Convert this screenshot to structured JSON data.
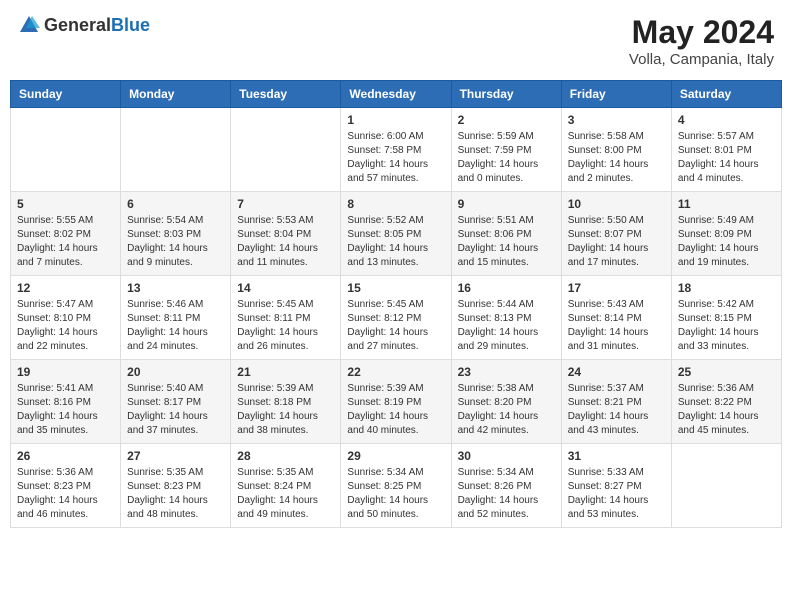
{
  "header": {
    "logo_general": "General",
    "logo_blue": "Blue",
    "month_title": "May 2024",
    "location": "Volla, Campania, Italy"
  },
  "days_of_week": [
    "Sunday",
    "Monday",
    "Tuesday",
    "Wednesday",
    "Thursday",
    "Friday",
    "Saturday"
  ],
  "weeks": [
    [
      {
        "day": "",
        "sunrise": "",
        "sunset": "",
        "daylight": ""
      },
      {
        "day": "",
        "sunrise": "",
        "sunset": "",
        "daylight": ""
      },
      {
        "day": "",
        "sunrise": "",
        "sunset": "",
        "daylight": ""
      },
      {
        "day": "1",
        "sunrise": "Sunrise: 6:00 AM",
        "sunset": "Sunset: 7:58 PM",
        "daylight": "Daylight: 14 hours and 57 minutes."
      },
      {
        "day": "2",
        "sunrise": "Sunrise: 5:59 AM",
        "sunset": "Sunset: 7:59 PM",
        "daylight": "Daylight: 14 hours and 0 minutes."
      },
      {
        "day": "3",
        "sunrise": "Sunrise: 5:58 AM",
        "sunset": "Sunset: 8:00 PM",
        "daylight": "Daylight: 14 hours and 2 minutes."
      },
      {
        "day": "4",
        "sunrise": "Sunrise: 5:57 AM",
        "sunset": "Sunset: 8:01 PM",
        "daylight": "Daylight: 14 hours and 4 minutes."
      }
    ],
    [
      {
        "day": "5",
        "sunrise": "Sunrise: 5:55 AM",
        "sunset": "Sunset: 8:02 PM",
        "daylight": "Daylight: 14 hours and 7 minutes."
      },
      {
        "day": "6",
        "sunrise": "Sunrise: 5:54 AM",
        "sunset": "Sunset: 8:03 PM",
        "daylight": "Daylight: 14 hours and 9 minutes."
      },
      {
        "day": "7",
        "sunrise": "Sunrise: 5:53 AM",
        "sunset": "Sunset: 8:04 PM",
        "daylight": "Daylight: 14 hours and 11 minutes."
      },
      {
        "day": "8",
        "sunrise": "Sunrise: 5:52 AM",
        "sunset": "Sunset: 8:05 PM",
        "daylight": "Daylight: 14 hours and 13 minutes."
      },
      {
        "day": "9",
        "sunrise": "Sunrise: 5:51 AM",
        "sunset": "Sunset: 8:06 PM",
        "daylight": "Daylight: 14 hours and 15 minutes."
      },
      {
        "day": "10",
        "sunrise": "Sunrise: 5:50 AM",
        "sunset": "Sunset: 8:07 PM",
        "daylight": "Daylight: 14 hours and 17 minutes."
      },
      {
        "day": "11",
        "sunrise": "Sunrise: 5:49 AM",
        "sunset": "Sunset: 8:09 PM",
        "daylight": "Daylight: 14 hours and 19 minutes."
      }
    ],
    [
      {
        "day": "12",
        "sunrise": "Sunrise: 5:47 AM",
        "sunset": "Sunset: 8:10 PM",
        "daylight": "Daylight: 14 hours and 22 minutes."
      },
      {
        "day": "13",
        "sunrise": "Sunrise: 5:46 AM",
        "sunset": "Sunset: 8:11 PM",
        "daylight": "Daylight: 14 hours and 24 minutes."
      },
      {
        "day": "14",
        "sunrise": "Sunrise: 5:45 AM",
        "sunset": "Sunset: 8:11 PM",
        "daylight": "Daylight: 14 hours and 26 minutes."
      },
      {
        "day": "15",
        "sunrise": "Sunrise: 5:45 AM",
        "sunset": "Sunset: 8:12 PM",
        "daylight": "Daylight: 14 hours and 27 minutes."
      },
      {
        "day": "16",
        "sunrise": "Sunrise: 5:44 AM",
        "sunset": "Sunset: 8:13 PM",
        "daylight": "Daylight: 14 hours and 29 minutes."
      },
      {
        "day": "17",
        "sunrise": "Sunrise: 5:43 AM",
        "sunset": "Sunset: 8:14 PM",
        "daylight": "Daylight: 14 hours and 31 minutes."
      },
      {
        "day": "18",
        "sunrise": "Sunrise: 5:42 AM",
        "sunset": "Sunset: 8:15 PM",
        "daylight": "Daylight: 14 hours and 33 minutes."
      }
    ],
    [
      {
        "day": "19",
        "sunrise": "Sunrise: 5:41 AM",
        "sunset": "Sunset: 8:16 PM",
        "daylight": "Daylight: 14 hours and 35 minutes."
      },
      {
        "day": "20",
        "sunrise": "Sunrise: 5:40 AM",
        "sunset": "Sunset: 8:17 PM",
        "daylight": "Daylight: 14 hours and 37 minutes."
      },
      {
        "day": "21",
        "sunrise": "Sunrise: 5:39 AM",
        "sunset": "Sunset: 8:18 PM",
        "daylight": "Daylight: 14 hours and 38 minutes."
      },
      {
        "day": "22",
        "sunrise": "Sunrise: 5:39 AM",
        "sunset": "Sunset: 8:19 PM",
        "daylight": "Daylight: 14 hours and 40 minutes."
      },
      {
        "day": "23",
        "sunrise": "Sunrise: 5:38 AM",
        "sunset": "Sunset: 8:20 PM",
        "daylight": "Daylight: 14 hours and 42 minutes."
      },
      {
        "day": "24",
        "sunrise": "Sunrise: 5:37 AM",
        "sunset": "Sunset: 8:21 PM",
        "daylight": "Daylight: 14 hours and 43 minutes."
      },
      {
        "day": "25",
        "sunrise": "Sunrise: 5:36 AM",
        "sunset": "Sunset: 8:22 PM",
        "daylight": "Daylight: 14 hours and 45 minutes."
      }
    ],
    [
      {
        "day": "26",
        "sunrise": "Sunrise: 5:36 AM",
        "sunset": "Sunset: 8:23 PM",
        "daylight": "Daylight: 14 hours and 46 minutes."
      },
      {
        "day": "27",
        "sunrise": "Sunrise: 5:35 AM",
        "sunset": "Sunset: 8:23 PM",
        "daylight": "Daylight: 14 hours and 48 minutes."
      },
      {
        "day": "28",
        "sunrise": "Sunrise: 5:35 AM",
        "sunset": "Sunset: 8:24 PM",
        "daylight": "Daylight: 14 hours and 49 minutes."
      },
      {
        "day": "29",
        "sunrise": "Sunrise: 5:34 AM",
        "sunset": "Sunset: 8:25 PM",
        "daylight": "Daylight: 14 hours and 50 minutes."
      },
      {
        "day": "30",
        "sunrise": "Sunrise: 5:34 AM",
        "sunset": "Sunset: 8:26 PM",
        "daylight": "Daylight: 14 hours and 52 minutes."
      },
      {
        "day": "31",
        "sunrise": "Sunrise: 5:33 AM",
        "sunset": "Sunset: 8:27 PM",
        "daylight": "Daylight: 14 hours and 53 minutes."
      },
      {
        "day": "",
        "sunrise": "",
        "sunset": "",
        "daylight": ""
      }
    ]
  ]
}
